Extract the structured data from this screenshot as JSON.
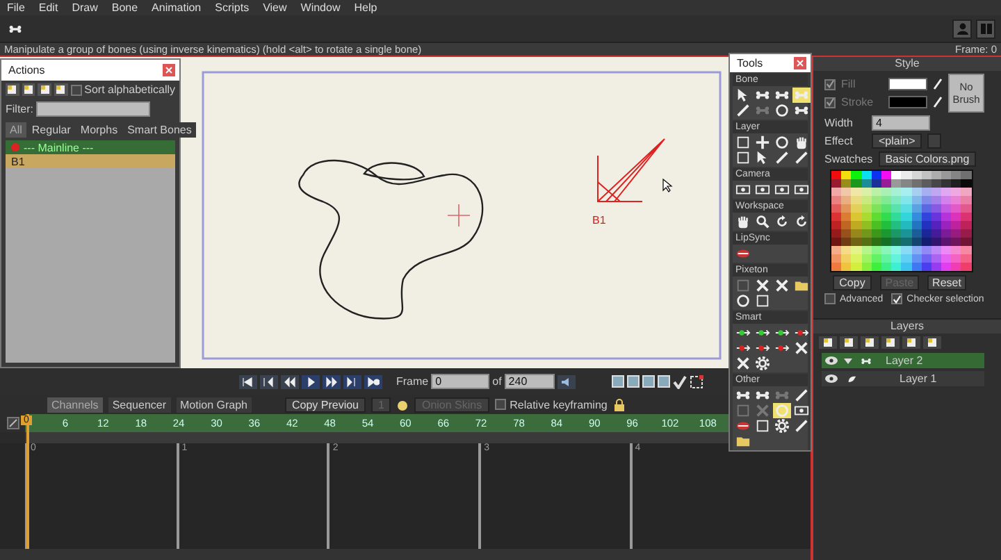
{
  "menu": [
    "File",
    "Edit",
    "Draw",
    "Bone",
    "Animation",
    "Scripts",
    "View",
    "Window",
    "Help"
  ],
  "status_bar": {
    "hint": "Manipulate a group of bones (using inverse kinematics) (hold <alt> to rotate a single bone)",
    "frame": "Frame: 0"
  },
  "canvas": {
    "bone_label": "B1"
  },
  "actions_window": {
    "title": "Actions",
    "sort_alphabetically": {
      "label": "Sort alphabetically",
      "checked": false
    },
    "filter": {
      "label": "Filter:"
    },
    "tabs": [
      {
        "label": "All",
        "selected": true
      },
      {
        "label": "Regular",
        "selected": false
      },
      {
        "label": "Morphs",
        "selected": false
      },
      {
        "label": "Smart Bones",
        "selected": false
      }
    ],
    "items": [
      {
        "label": "--- Mainline ---",
        "kind": "mainline",
        "selected": false
      },
      {
        "label": "B1",
        "kind": "action",
        "selected": true
      }
    ]
  },
  "tools_window": {
    "title": "Tools",
    "sections": [
      {
        "title": "Bone",
        "tools": [
          {
            "kind": "arrow",
            "selected": false,
            "disabled": false
          },
          {
            "kind": "bone",
            "selected": false,
            "disabled": false
          },
          {
            "kind": "bone",
            "selected": false,
            "disabled": false
          },
          {
            "kind": "bone",
            "selected": true,
            "disabled": false
          },
          {
            "kind": "pen",
            "selected": false,
            "disabled": false
          },
          {
            "kind": "bone",
            "selected": false,
            "disabled": true
          },
          {
            "kind": "circle",
            "selected": false,
            "disabled": false
          },
          {
            "kind": "bone",
            "selected": false,
            "disabled": false
          }
        ]
      },
      {
        "title": "Layer",
        "tools": [
          {
            "kind": "square",
            "selected": false,
            "disabled": false
          },
          {
            "kind": "plus",
            "selected": false,
            "disabled": false
          },
          {
            "kind": "circle",
            "selected": false,
            "disabled": false
          },
          {
            "kind": "hand",
            "selected": false,
            "disabled": false
          },
          {
            "kind": "square",
            "selected": false,
            "disabled": false
          },
          {
            "kind": "arrow",
            "selected": false,
            "disabled": false
          },
          {
            "kind": "pen",
            "selected": false,
            "disabled": false
          },
          {
            "kind": "pen",
            "selected": false,
            "disabled": false
          }
        ]
      },
      {
        "title": "Camera",
        "tools": [
          {
            "kind": "camera",
            "selected": false,
            "disabled": false
          },
          {
            "kind": "camera",
            "selected": false,
            "disabled": false
          },
          {
            "kind": "camera",
            "selected": false,
            "disabled": false
          },
          {
            "kind": "camera",
            "selected": false,
            "disabled": false
          }
        ]
      },
      {
        "title": "Workspace",
        "tools": [
          {
            "kind": "hand",
            "selected": false,
            "disabled": false
          },
          {
            "kind": "magnifier",
            "selected": false,
            "disabled": false
          },
          {
            "kind": "rotate",
            "selected": false,
            "disabled": false
          },
          {
            "kind": "rotate",
            "selected": false,
            "disabled": false
          }
        ]
      },
      {
        "title": "LipSync",
        "tools": [
          {
            "kind": "mouth",
            "selected": false,
            "disabled": false
          }
        ]
      },
      {
        "title": "Pixeton",
        "tools": [
          {
            "kind": "square",
            "selected": false,
            "disabled": true
          },
          {
            "kind": "cross",
            "selected": false,
            "disabled": false
          },
          {
            "kind": "cross",
            "selected": false,
            "disabled": false
          },
          {
            "kind": "folder",
            "selected": false,
            "disabled": false
          },
          {
            "kind": "circle",
            "selected": false,
            "disabled": false
          },
          {
            "kind": "square",
            "selected": false,
            "disabled": false
          }
        ]
      },
      {
        "title": "Smart",
        "tools": [
          {
            "kind": "dot-arrow-green",
            "selected": false,
            "disabled": false
          },
          {
            "kind": "dot-arrow-green",
            "selected": false,
            "disabled": false
          },
          {
            "kind": "dot-arrow-green",
            "selected": false,
            "disabled": false
          },
          {
            "kind": "dot-arrow",
            "selected": false,
            "disabled": false
          },
          {
            "kind": "dot-arrow",
            "selected": false,
            "disabled": false
          },
          {
            "kind": "dot-arrow",
            "selected": false,
            "disabled": false
          },
          {
            "kind": "dot-arrow",
            "selected": false,
            "disabled": false
          },
          {
            "kind": "cross",
            "selected": false,
            "disabled": false
          },
          {
            "kind": "cross",
            "selected": false,
            "disabled": false
          },
          {
            "kind": "gear",
            "selected": false,
            "disabled": false
          }
        ]
      },
      {
        "title": "Other",
        "tools": [
          {
            "kind": "bone",
            "selected": false,
            "disabled": false
          },
          {
            "kind": "bone",
            "selected": false,
            "disabled": false
          },
          {
            "kind": "bone",
            "selected": false,
            "disabled": true
          },
          {
            "kind": "pen",
            "selected": false,
            "disabled": false
          },
          {
            "kind": "square",
            "selected": false,
            "disabled": true
          },
          {
            "kind": "cross",
            "selected": false,
            "disabled": true
          },
          {
            "kind": "circle",
            "selected": true,
            "disabled": false
          },
          {
            "kind": "camera",
            "selected": false,
            "disabled": false
          },
          {
            "kind": "mouth",
            "selected": false,
            "disabled": false
          },
          {
            "kind": "square",
            "selected": false,
            "disabled": false
          },
          {
            "kind": "gear",
            "selected": false,
            "disabled": false
          },
          {
            "kind": "pen",
            "selected": false,
            "disabled": false
          },
          {
            "kind": "folder",
            "selected": false,
            "disabled": false
          }
        ]
      }
    ]
  },
  "playback": {
    "frame_label": "Frame",
    "frame_value": "0",
    "of_label": "of",
    "total": "240"
  },
  "timeline": {
    "tabs": [
      {
        "label": "Channels",
        "selected": true
      },
      {
        "label": "Sequencer",
        "selected": false
      },
      {
        "label": "Motion Graph",
        "selected": false
      }
    ],
    "copy_previous": "Copy Previou",
    "interval": {
      "value": "1",
      "disabled": true
    },
    "onion_skins": {
      "label": "Onion Skins",
      "disabled": true
    },
    "relative_keyframing": {
      "label": "Relative keyframing",
      "checked": false
    },
    "playhead_label": "0",
    "frame_ticks": [
      "6",
      "12",
      "18",
      "24",
      "30",
      "36",
      "42",
      "48",
      "54",
      "60",
      "66",
      "72",
      "78",
      "84",
      "90",
      "96",
      "102",
      "108"
    ],
    "second_marks": [
      "0",
      "1",
      "2",
      "3",
      "4"
    ]
  },
  "style_panel": {
    "title": "Style",
    "colors": [
      {
        "label": "Fill",
        "checked": true,
        "disabled": true,
        "color": "#ffffff"
      },
      {
        "label": "Stroke",
        "checked": true,
        "disabled": true,
        "color": "#000000"
      }
    ],
    "width": {
      "label": "Width",
      "value": "4"
    },
    "effect": {
      "label": "Effect",
      "value": "<plain>"
    },
    "brush_button": "No Brush",
    "swatches": {
      "label": "Swatches",
      "value": "Basic Colors.png"
    },
    "buttons": [
      {
        "label": "Copy",
        "disabled": false
      },
      {
        "label": "Paste",
        "disabled": true
      },
      {
        "label": "Reset",
        "disabled": false
      }
    ],
    "options": [
      {
        "label": "Advanced",
        "checked": false
      },
      {
        "label": "Checker selection",
        "checked": true
      }
    ]
  },
  "layers_panel": {
    "title": "Layers",
    "layers": [
      {
        "name": "Layer 2",
        "kind": "bone",
        "selected": true,
        "expanded": true,
        "children": [
          {
            "name": "Layer 1",
            "kind": "vector",
            "selected": false
          }
        ]
      }
    ]
  }
}
